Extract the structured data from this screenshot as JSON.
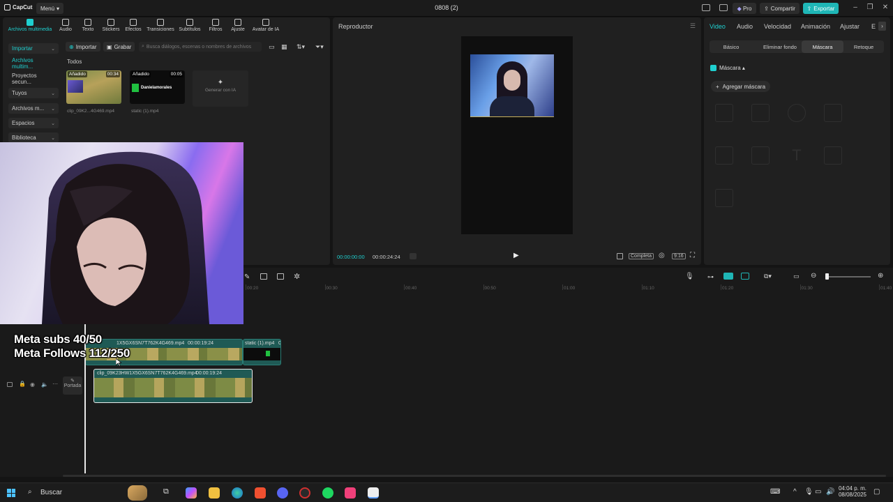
{
  "titlebar": {
    "app_name": "CapCut",
    "menu_label": "Menú",
    "project_title": "0808 (2)",
    "pro_label": "Pro",
    "share_label": "Compartir",
    "export_label": "Exportar",
    "accent": "#1fb6b6"
  },
  "media": {
    "tabs": [
      {
        "label": "Archivos multimedia",
        "icon": "media-icon"
      },
      {
        "label": "Audio",
        "icon": "audio-icon"
      },
      {
        "label": "Texto",
        "icon": "text-icon"
      },
      {
        "label": "Stickers",
        "icon": "sticker-icon"
      },
      {
        "label": "Efectos",
        "icon": "effects-icon"
      },
      {
        "label": "Transiciones",
        "icon": "transition-icon"
      },
      {
        "label": "Subtítulos",
        "icon": "subtitles-icon"
      },
      {
        "label": "Filtros",
        "icon": "filters-icon"
      },
      {
        "label": "Ajuste",
        "icon": "adjust-icon"
      },
      {
        "label": "Avatar de IA",
        "icon": "avatar-icon"
      }
    ],
    "sidebar": [
      "Importar",
      "Archivos multim...",
      "Proyectos secun...",
      "Tuyos",
      "Archivos m...",
      "Espacios",
      "Biblioteca"
    ],
    "import_label": "Importar",
    "record_label": "Grabar",
    "search_placeholder": "Busca diálogos, escenas o nombres de archivos",
    "section_label": "Todos",
    "items": [
      {
        "tag": "Añadido",
        "duration": "00:34",
        "name": "clip_09K2...4G469.mp4"
      },
      {
        "tag": "Añadido",
        "duration": "00:05",
        "name": "static (1).mp4",
        "thumb_text": "Danielamorales"
      }
    ],
    "generate_label": "Generar con IA"
  },
  "player": {
    "title": "Reproductor",
    "current_time": "00:00:00:00",
    "total_time": "00:00:24:24",
    "complete_label": "Completa",
    "ratio_label": "9:16"
  },
  "props": {
    "tabs": [
      "Video",
      "Audio",
      "Velocidad",
      "Animación",
      "Ajustar",
      "E"
    ],
    "subtabs": [
      "Básico",
      "Eliminar fondo",
      "Máscara",
      "Retoque"
    ],
    "mask_label": "Máscara",
    "add_mask_label": "Agregar máscara"
  },
  "timeline": {
    "ruler": [
      "00:20",
      "00:30",
      "00:40",
      "00:50",
      "01:00",
      "01:10",
      "01:20",
      "01:30",
      "01:40"
    ],
    "clip_top_label": "1X5GX6SN7T762K4G469.mp4",
    "clip_top_duration": "00:00:19:24",
    "clip_static_label": "static (1).mp4",
    "clip_static_duration": "0",
    "clip_main_label": "clip_09K23HW1X5GX6SN7T762K4G469.mp4",
    "clip_main_duration": "00:00:19:24",
    "cover_label": "Portada"
  },
  "overlay": {
    "line1": "Meta subs 40/50",
    "line2": "Meta Follows 112/250"
  },
  "taskbar": {
    "search_label": "Buscar",
    "time": "04:04 p. m.",
    "date": "08/08/2025"
  }
}
